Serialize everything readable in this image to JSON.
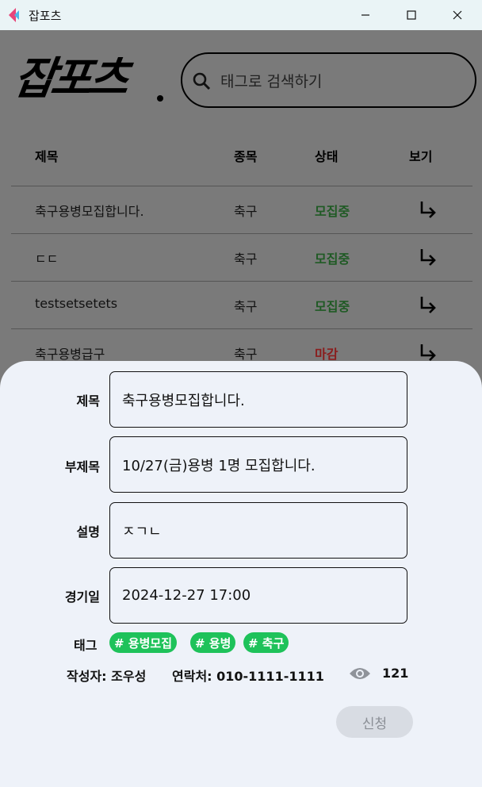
{
  "window": {
    "title": "잡포츠",
    "minimize_glyph": "—",
    "maximize_glyph": "☐",
    "close_glyph": "✕"
  },
  "header": {
    "logo_text": "잡포츠",
    "search_placeholder": "태그로 검색하기"
  },
  "table": {
    "columns": [
      "제목",
      "종목",
      "상태",
      "보기"
    ],
    "rows": [
      {
        "title": "축구용병모집합니다.",
        "sport": "축구",
        "status": "모집중",
        "status_type": "open"
      },
      {
        "title": "ㄷㄷ",
        "sport": "축구",
        "status": "모집중",
        "status_type": "open"
      },
      {
        "title": "testsetsetets",
        "sport": "축구",
        "status": "모집중",
        "status_type": "open"
      },
      {
        "title": "축구용병급구",
        "sport": "축구",
        "status": "마감",
        "status_type": "closed"
      }
    ]
  },
  "detail": {
    "labels": {
      "title": "제목",
      "subtitle": "부제목",
      "description": "설명",
      "game_date": "경기일",
      "tags": "태그"
    },
    "values": {
      "title": "축구용병모집합니다.",
      "subtitle": "10/27(금)용병 1명 모집합니다.",
      "description": "ㅈㄱㄴ",
      "game_date": "2024-12-27 17:00"
    },
    "tags": [
      "# 용병모집",
      "# 용병",
      "# 축구"
    ],
    "author": "작성자: 조우성",
    "contact": "연락처: 010-1111-1111",
    "views": "121",
    "apply_label": "신청"
  },
  "colors": {
    "tag_green": "#1ec25a",
    "status_open": "#1f5a24",
    "status_closed": "#8a1d1d",
    "sheet_bg": "#eef2f9",
    "backdrop": "#7a7a7a"
  }
}
